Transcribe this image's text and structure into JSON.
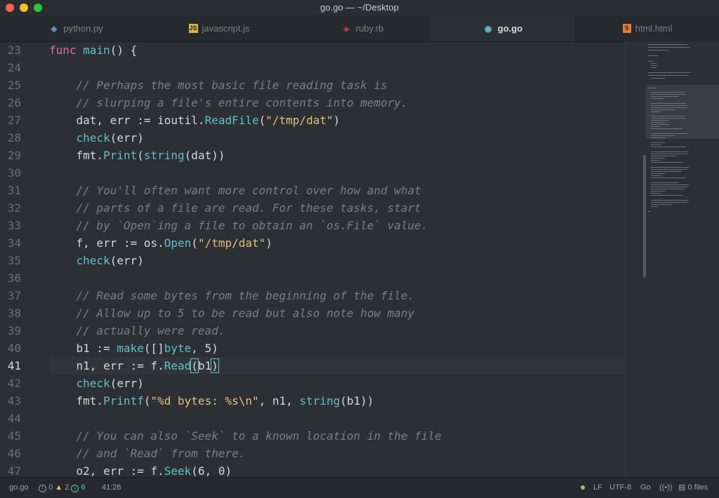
{
  "window": {
    "title": "go.go — ~/Desktop"
  },
  "tabs": [
    {
      "label": "python.py",
      "icon": "python-icon",
      "color": "#5a8fcf"
    },
    {
      "label": "javascript.js",
      "icon": "javascript-icon",
      "color": "#d9b44a"
    },
    {
      "label": "ruby.rb",
      "icon": "ruby-icon",
      "color": "#c6414a"
    },
    {
      "label": "go.go",
      "icon": "go-icon",
      "color": "#5fc1c8"
    },
    {
      "label": "html.html",
      "icon": "html5-icon",
      "color": "#e07a3a"
    }
  ],
  "editor": {
    "line_numbers": [
      "23",
      "24",
      "25",
      "26",
      "27",
      "28",
      "29",
      "30",
      "31",
      "32",
      "33",
      "34",
      "35",
      "36",
      "37",
      "38",
      "39",
      "40",
      "41",
      "42",
      "43",
      "44",
      "45",
      "46",
      "47"
    ],
    "current_line": "41"
  },
  "status": {
    "file": "go.go",
    "errors": "0",
    "warnings": "2",
    "infos": "6",
    "cursor": "41:26",
    "line_ending": "LF",
    "encoding": "UTF-8",
    "grammar": "Go",
    "files": "0 files"
  }
}
